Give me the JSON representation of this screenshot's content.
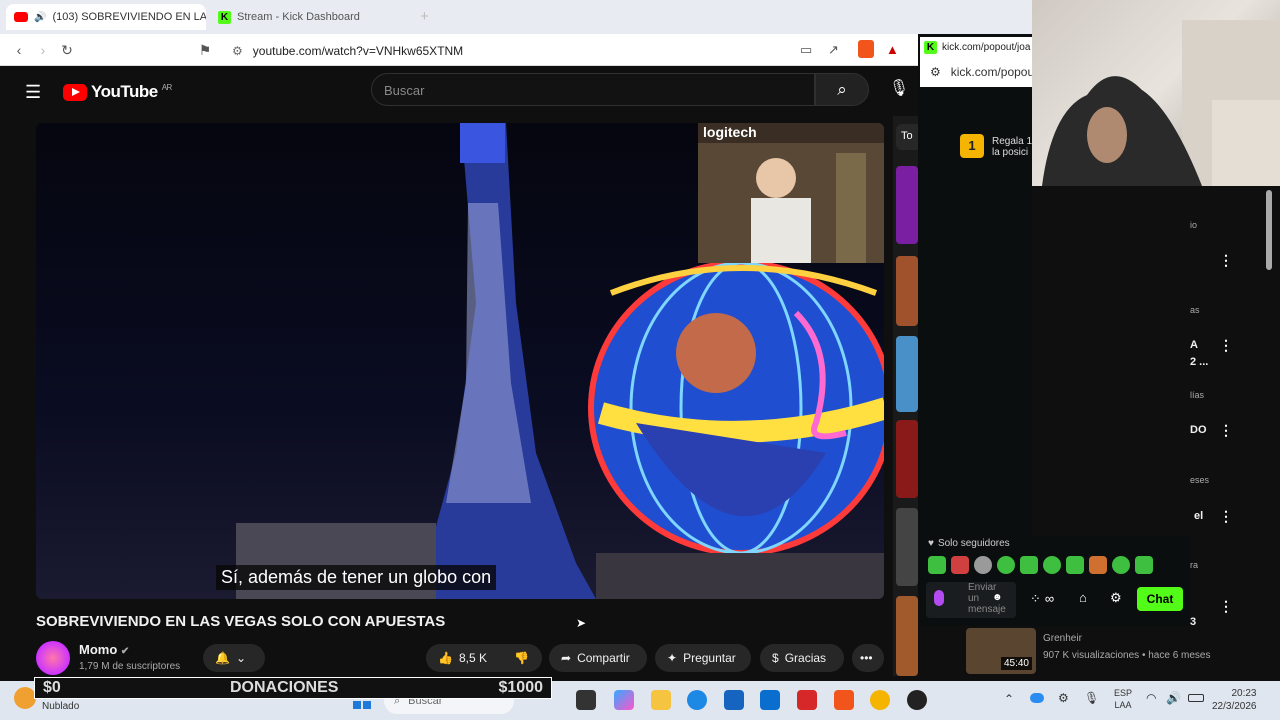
{
  "browser": {
    "tabs": [
      {
        "title": "(103) SOBREVIVIENDO EN LA"
      },
      {
        "title": "Stream - Kick Dashboard"
      }
    ],
    "url": "youtube.com/watch?v=VNHkw65XTNM"
  },
  "youtube": {
    "logo_text": "YouTube",
    "region": "AR",
    "search_placeholder": "Buscar",
    "subtitle": "Sí, además de tener un globo con",
    "video_title": "SOBREVIVIENDO EN LAS VEGAS SOLO CON APUESTAS",
    "channel": "Momo",
    "subscribers": "1,79 M de suscriptores",
    "likes": "8,5 K",
    "share": "Compartir",
    "ask": "Preguntar",
    "thanks": "Gracias",
    "top_chip": "To"
  },
  "recommendations": [
    {
      "frag": "io"
    },
    {
      "frag": "as"
    },
    {
      "frag": "A"
    },
    {
      "frag": "2 ..."
    },
    {
      "frag": "lías"
    },
    {
      "frag": "DO"
    },
    {
      "frag": "eses"
    },
    {
      "frag": "el"
    },
    {
      "frag": "ra"
    },
    {
      "frag": "3"
    },
    {
      "channel": "Grenheir",
      "meta": "907 K visualizaciones • hace 6 meses",
      "duration": "45:40"
    }
  ],
  "kick": {
    "popout_url_1": "kick.com/popout/joa",
    "popout_url_2": "kick.com/popou",
    "leader_rank": "1",
    "leader_text_1": "Regala 1",
    "leader_text_2": "la posici",
    "followers_only": "Solo seguidores",
    "message_placeholder_1": "Enviar",
    "message_placeholder_2": "un",
    "message_placeholder_3": "mensaje",
    "chat_button": "Chat"
  },
  "overlay": {
    "left_amount": "$0",
    "label": "DONACIONES",
    "right_amount": "$1000"
  },
  "taskbar": {
    "weather": "Nublado",
    "search": "Buscar",
    "lang_1": "ESP",
    "lang_2": "LAA",
    "time": "20:23",
    "date": "22/3/2026"
  },
  "colors": {
    "youtube_red": "#ff0000",
    "kick_green": "#53fc18"
  }
}
